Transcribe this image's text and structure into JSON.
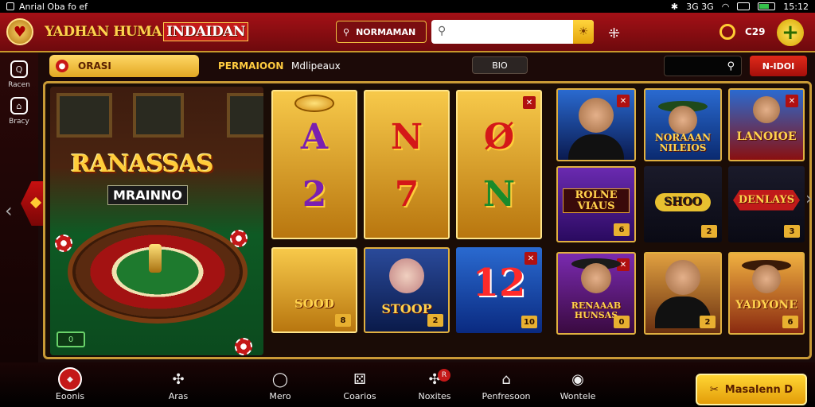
{
  "status": {
    "notification_text": "Anrial Oba fo ef",
    "time": "15:12",
    "signal": "3G 3G"
  },
  "header": {
    "brand": "YADHAN HUMA",
    "brand_sub": "INDAIDAN",
    "nav_pill": "NORMAMAN",
    "search_placeholder": "",
    "coins": "C29"
  },
  "rail": [
    {
      "label": "Racen",
      "icon": "search-icon"
    },
    {
      "label": "Bracy",
      "icon": "store-icon"
    }
  ],
  "subbar": {
    "category": "ORASI",
    "tab_active": "PERMAIOON",
    "tab_other": "Mdlipeaux",
    "chip": "BIO",
    "button": "N-IDOI"
  },
  "hero": {
    "title": "RANASSAS",
    "subtitle": "MRAINNO",
    "badge": "0"
  },
  "reels": [
    {
      "top_symbol": "A",
      "bottom_symbol": "2",
      "num": ""
    },
    {
      "top_symbol": "N",
      "bottom_symbol": "7",
      "num": ""
    },
    {
      "top_symbol": "Ø",
      "bottom_symbol": "N",
      "num": ""
    }
  ],
  "reel_bottom": [
    {
      "label": "SOOD",
      "num": "8"
    },
    {
      "label": "STOOP",
      "num": "2"
    },
    {
      "label": "12",
      "num": "10"
    }
  ],
  "games_row1": [
    {
      "label": "",
      "num": ""
    },
    {
      "label": "NORAAAN NILEIOS",
      "num": ""
    },
    {
      "label": "LANOIOE",
      "num": ""
    }
  ],
  "games_row2": [
    {
      "label": "ROLNE VIAUS",
      "num": "6"
    },
    {
      "label": "SHOO",
      "num": "2"
    },
    {
      "label": "DENLAYS",
      "num": "3"
    }
  ],
  "games_row3": [
    {
      "label": "RENAAAB HUNSAS",
      "num": "0"
    },
    {
      "label": "",
      "num": "2"
    },
    {
      "label": "YADYONE",
      "num": "6"
    }
  ],
  "bottom_nav": [
    {
      "label": "Eoonis",
      "icon": "home-icon"
    },
    {
      "label": "Aras",
      "icon": "puzzle-icon"
    },
    {
      "label": "Mero",
      "icon": "chat-icon"
    },
    {
      "label": "Coarios",
      "icon": "casino-icon"
    },
    {
      "label": "Noxites",
      "icon": "puzzle-notify-icon",
      "badge": "R"
    },
    {
      "label": "Penfresoon",
      "icon": "house-icon"
    },
    {
      "label": "Wontele",
      "icon": "speaker-icon"
    }
  ],
  "cta": "Masalenn D",
  "colors": {
    "header_red": "#a41016",
    "gold": "#ffd34e",
    "accent_yellow": "#f0c040"
  }
}
